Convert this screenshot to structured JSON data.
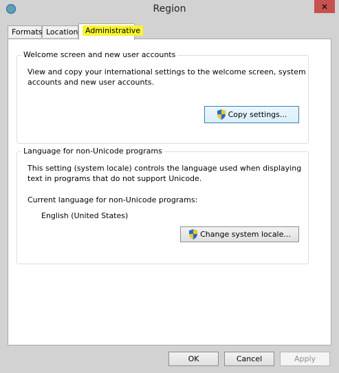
{
  "window": {
    "title": "Region"
  },
  "tabs": [
    {
      "label": "Formats"
    },
    {
      "label": "Location"
    },
    {
      "label": "Administrative"
    }
  ],
  "welcome_group": {
    "title": "Welcome screen and new user accounts",
    "description_line1": "View and copy your international settings to the welcome screen, system",
    "description_line2": "accounts and new user accounts.",
    "button_label": "Copy settings..."
  },
  "unicode_group": {
    "title": "Language for non-Unicode programs",
    "description_line1": "This setting (system locale) controls the language used when displaying",
    "description_line2": "text in programs that do not support Unicode.",
    "current_label": "Current language for non-Unicode programs:",
    "current_value": "English (United States)",
    "button_label": "Change system locale..."
  },
  "footer": {
    "ok_label": "OK",
    "cancel_label": "Cancel",
    "apply_label": "Apply"
  },
  "icons": {
    "app": "globe-icon",
    "close": "close-icon",
    "uac": "uac-shield-icon"
  },
  "colors": {
    "highlight": "#f7f431",
    "close": "#c75050",
    "frame": "#d2d2d2"
  }
}
